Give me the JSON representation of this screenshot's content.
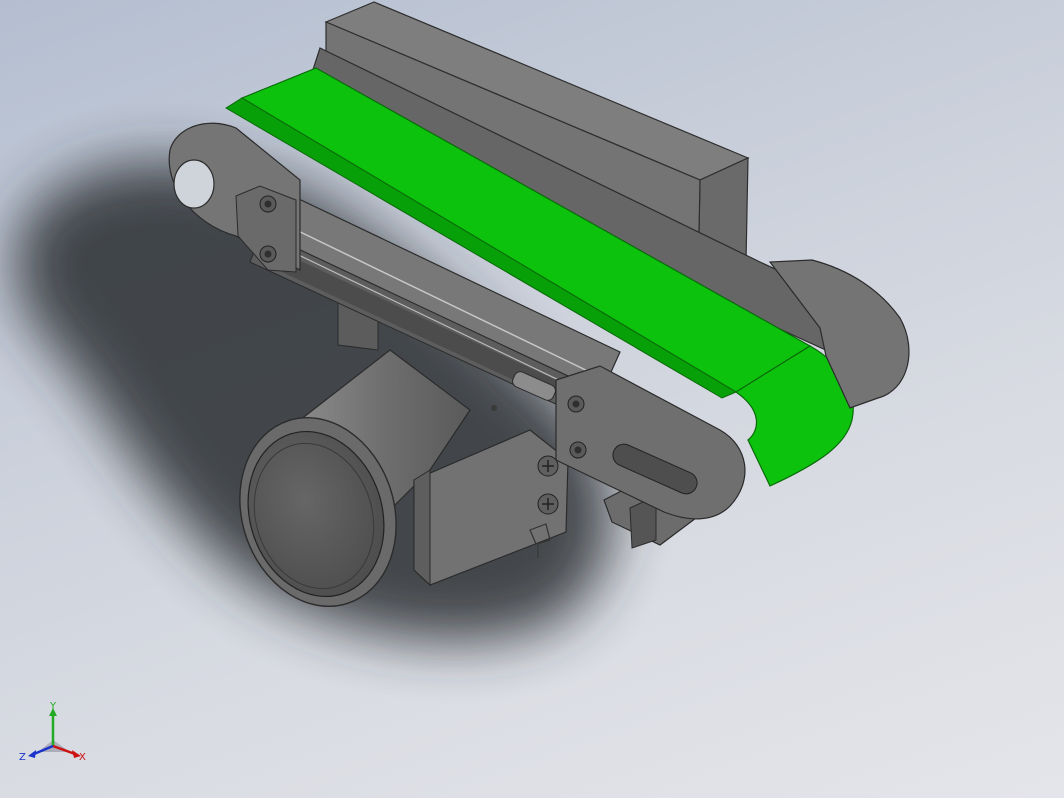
{
  "viewport": {
    "background_top": "#b4bed0",
    "background_bottom": "#e4e5ea"
  },
  "model": {
    "belt_color": "#0cc20c",
    "frame_color": "#6f6f6f",
    "motor_color": "#6b6b6b"
  },
  "triad": {
    "x_label": "X",
    "y_label": "Y",
    "z_label": "Z",
    "x_color": "#cc1111",
    "y_color": "#22aa22",
    "z_color": "#1a33cc"
  }
}
